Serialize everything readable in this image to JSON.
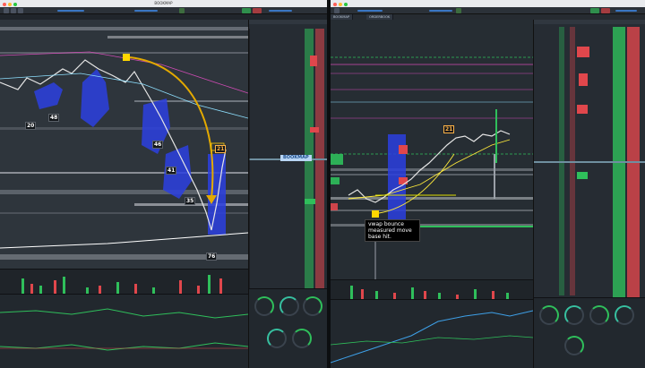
{
  "colors": {
    "buy": "#2fbf5b",
    "sell": "#e0474c",
    "accent": "#3a76c4",
    "marker": "#ffd600"
  },
  "left_window": {
    "title": "BOOKMAP",
    "brand": "BOOKMAP",
    "markers": [
      "48",
      "20",
      "46",
      "41",
      "21",
      "35",
      "76"
    ]
  },
  "right_window": {
    "tabs": [
      "BOOKMAP",
      "ORDERBOOK"
    ],
    "markers": [
      "21"
    ],
    "annotation": [
      "vwap bounce",
      "measured move",
      "base hit."
    ]
  },
  "icons": [
    "close-dot-icon",
    "minimize-dot-icon",
    "zoom-dot-icon",
    "gear-icon"
  ]
}
